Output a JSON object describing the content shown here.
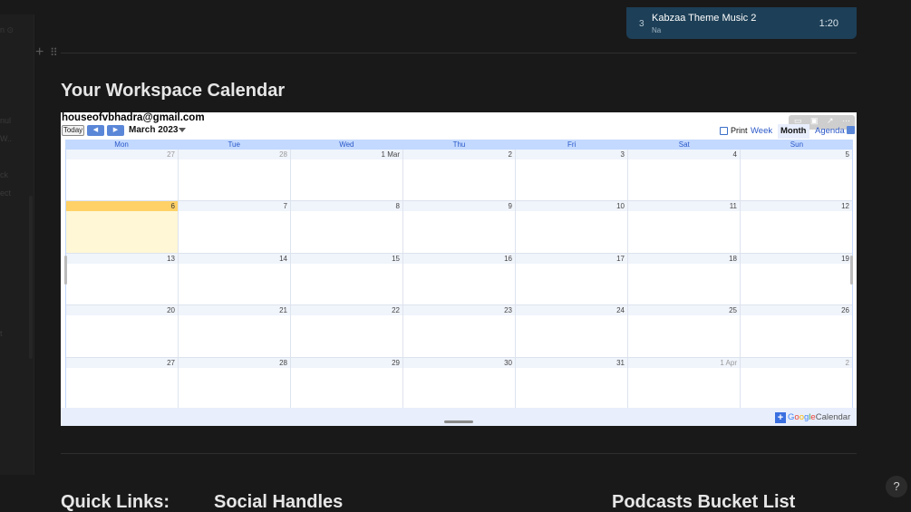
{
  "sidebar": {
    "fragments": [
      "n ⊙",
      "nul",
      "W..",
      "ck",
      "ect",
      "t"
    ]
  },
  "block_controls": {
    "plus": "+",
    "drag": "⠿"
  },
  "player": {
    "track_number": "3",
    "title": "Kabzaa Theme Music 2",
    "artist": "Na",
    "duration": "1:20"
  },
  "heading": "Your Workspace Calendar",
  "calendar": {
    "account": "houseofvbhadra@gmail.com",
    "today_label": "Today",
    "prev_icon": "◀",
    "next_icon": "▶",
    "month_label": "March 2023",
    "print_label": "Print",
    "views": {
      "week": "Week",
      "month": "Month",
      "agenda": "Agenda"
    },
    "active_view": "Month",
    "days_of_week": [
      "Mon",
      "Tue",
      "Wed",
      "Thu",
      "Fri",
      "Sat",
      "Sun"
    ],
    "weeks": [
      [
        "27",
        "28",
        "1 Mar",
        "2",
        "3",
        "4",
        "5"
      ],
      [
        "6",
        "7",
        "8",
        "9",
        "10",
        "11",
        "12"
      ],
      [
        "13",
        "14",
        "15",
        "16",
        "17",
        "18",
        "19"
      ],
      [
        "20",
        "21",
        "22",
        "23",
        "24",
        "25",
        "26"
      ],
      [
        "27",
        "28",
        "29",
        "30",
        "31",
        "1 Apr",
        "2"
      ]
    ],
    "today": "6",
    "footer": {
      "plus": "+",
      "google_letters": [
        "G",
        "o",
        "o",
        "g",
        "l",
        "e"
      ],
      "calendar_word": "Calendar"
    },
    "colors": {
      "header": "#c3d9ff",
      "today": "#ffd166",
      "accent": "#2a58c8"
    }
  },
  "sections": [
    "Quick Links:",
    "Social Handles",
    "Podcasts Bucket List"
  ],
  "help_label": "?"
}
